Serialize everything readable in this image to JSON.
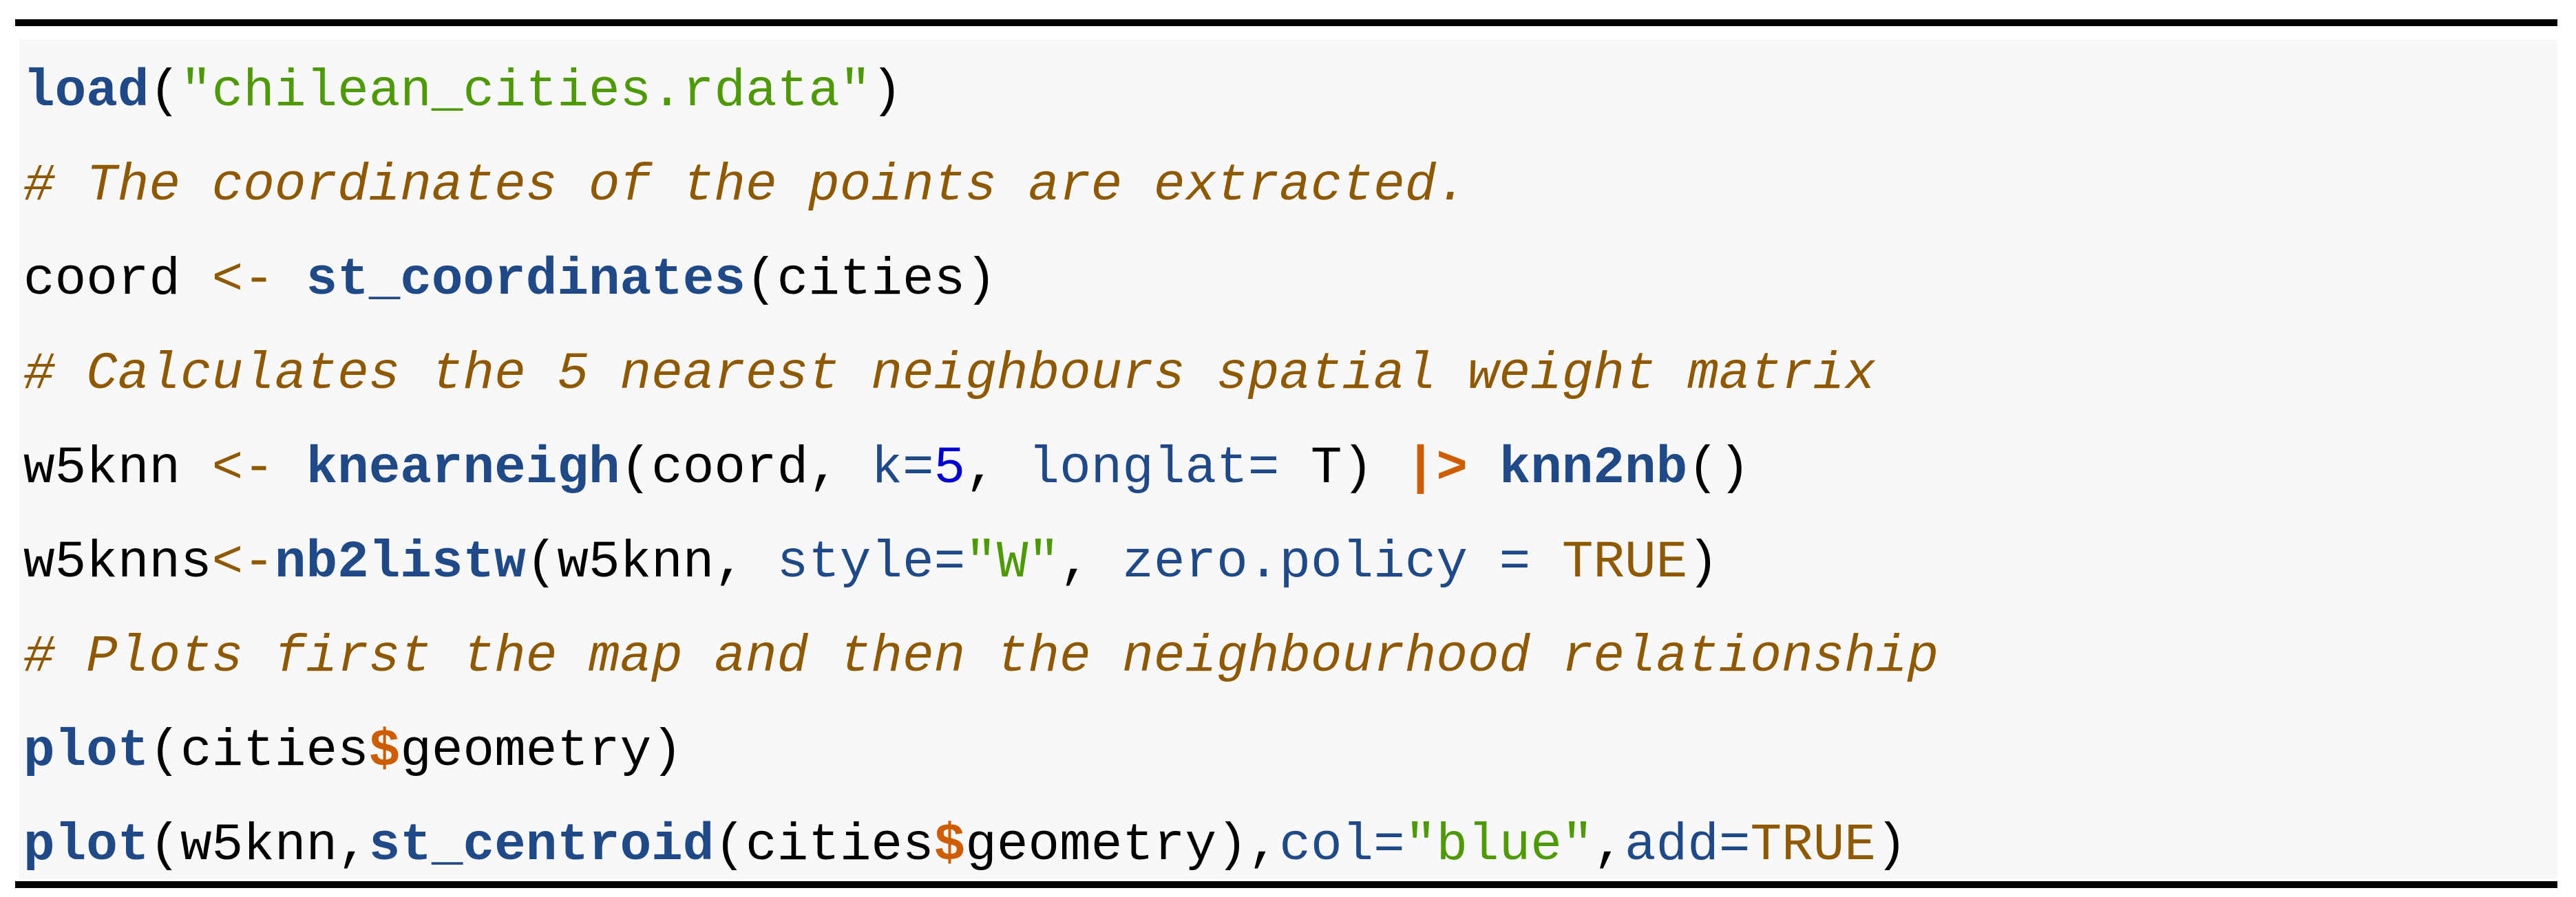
{
  "code": {
    "language": "r",
    "theme_colors": {
      "background": "#f8f8f8",
      "function": "#204a87",
      "string": "#4e9a06",
      "comment": "#8f5902",
      "operator": "#ce5c00",
      "number": "#0000cf",
      "constant": "#8f5902",
      "text": "#000000"
    },
    "lines": [
      [
        {
          "t": "fu",
          "v": "load"
        },
        {
          "t": "nf",
          "v": "("
        },
        {
          "t": "st",
          "v": "\"chilean_cities.rdata\""
        },
        {
          "t": "nf",
          "v": ")"
        }
      ],
      [
        {
          "t": "co",
          "v": "# The coordinates of the points are extracted."
        }
      ],
      [
        {
          "t": "nf",
          "v": "coord "
        },
        {
          "t": "ot",
          "v": "<-"
        },
        {
          "t": "nf",
          "v": " "
        },
        {
          "t": "fu",
          "v": "st_coordinates"
        },
        {
          "t": "nf",
          "v": "(cities)"
        }
      ],
      [
        {
          "t": "co",
          "v": "# Calculates the 5 nearest neighbours spatial weight matrix"
        }
      ],
      [
        {
          "t": "nf",
          "v": "w5knn "
        },
        {
          "t": "ot",
          "v": "<-"
        },
        {
          "t": "nf",
          "v": " "
        },
        {
          "t": "fu",
          "v": "knearneigh"
        },
        {
          "t": "nf",
          "v": "(coord, "
        },
        {
          "t": "ar",
          "v": "k="
        },
        {
          "t": "dv",
          "v": "5"
        },
        {
          "t": "nf",
          "v": ", "
        },
        {
          "t": "ar",
          "v": "longlat="
        },
        {
          "t": "nf",
          "v": " T) "
        },
        {
          "t": "op",
          "v": "|>"
        },
        {
          "t": "nf",
          "v": " "
        },
        {
          "t": "fu",
          "v": "knn2nb"
        },
        {
          "t": "nf",
          "v": "()"
        }
      ],
      [
        {
          "t": "nf",
          "v": "w5knns"
        },
        {
          "t": "ot",
          "v": "<-"
        },
        {
          "t": "fu",
          "v": "nb2listw"
        },
        {
          "t": "nf",
          "v": "(w5knn, "
        },
        {
          "t": "ar",
          "v": "style="
        },
        {
          "t": "st",
          "v": "\"W\""
        },
        {
          "t": "nf",
          "v": ", "
        },
        {
          "t": "ar",
          "v": "zero.policy ="
        },
        {
          "t": "nf",
          "v": " "
        },
        {
          "t": "cn",
          "v": "TRUE"
        },
        {
          "t": "nf",
          "v": ")"
        }
      ],
      [
        {
          "t": "co",
          "v": "# Plots first the map and then the neighbourhood relationship"
        }
      ],
      [
        {
          "t": "fu",
          "v": "plot"
        },
        {
          "t": "nf",
          "v": "(cities"
        },
        {
          "t": "op",
          "v": "$"
        },
        {
          "t": "nf",
          "v": "geometry)"
        }
      ],
      [
        {
          "t": "fu",
          "v": "plot"
        },
        {
          "t": "nf",
          "v": "(w5knn,"
        },
        {
          "t": "fu",
          "v": "st_centroid"
        },
        {
          "t": "nf",
          "v": "(cities"
        },
        {
          "t": "op",
          "v": "$"
        },
        {
          "t": "nf",
          "v": "geometry),"
        },
        {
          "t": "ar",
          "v": "col="
        },
        {
          "t": "st",
          "v": "\"blue\""
        },
        {
          "t": "nf",
          "v": ","
        },
        {
          "t": "ar",
          "v": "add="
        },
        {
          "t": "cn",
          "v": "TRUE"
        },
        {
          "t": "nf",
          "v": ")"
        }
      ]
    ]
  }
}
